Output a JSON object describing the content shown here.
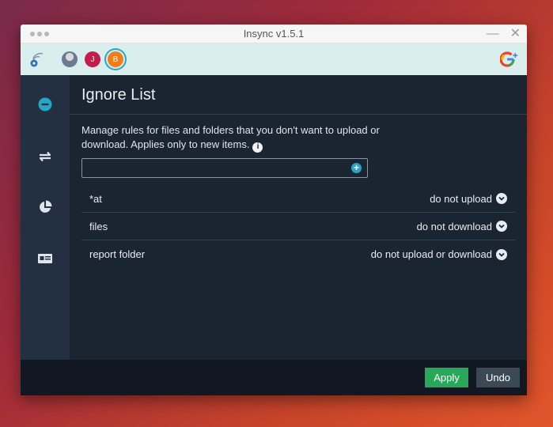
{
  "window": {
    "title": "Insync v1.5.1",
    "minimize_label": "—",
    "close_label": "✕"
  },
  "toolbar": {
    "status_icon": "wifi-sync-icon",
    "accounts": [
      {
        "initial": "",
        "color": "#6b7a90"
      },
      {
        "initial": "J",
        "color": "#c41c4d"
      },
      {
        "initial": "B",
        "color": "#f07c1c"
      }
    ],
    "add_account_icon": "google-plus-icon"
  },
  "sidebar": {
    "items": [
      {
        "icon": "minus-circle-icon",
        "active": true
      },
      {
        "icon": "sync-icon",
        "active": false
      },
      {
        "icon": "pie-chart-icon",
        "active": false
      },
      {
        "icon": "id-card-icon",
        "active": false
      }
    ],
    "active_color": "#27a6c9"
  },
  "main": {
    "heading": "Ignore List",
    "description": "Manage rules for files and folders that you don't want to upload or download. Applies only to new items.",
    "info_icon_label": "i",
    "input": {
      "value": "",
      "placeholder": ""
    },
    "add_label": "+",
    "rules": [
      {
        "name": "*at",
        "action": "do not upload"
      },
      {
        "name": "files",
        "action": "do not download"
      },
      {
        "name": "report folder",
        "action": "do not upload or download"
      }
    ]
  },
  "footer": {
    "apply_label": "Apply",
    "undo_label": "Undo"
  },
  "colors": {
    "accent": "#27a6c9",
    "apply": "#28a75a",
    "undo": "#3d4855",
    "background": "#1b2431",
    "sidebar": "#233042"
  }
}
